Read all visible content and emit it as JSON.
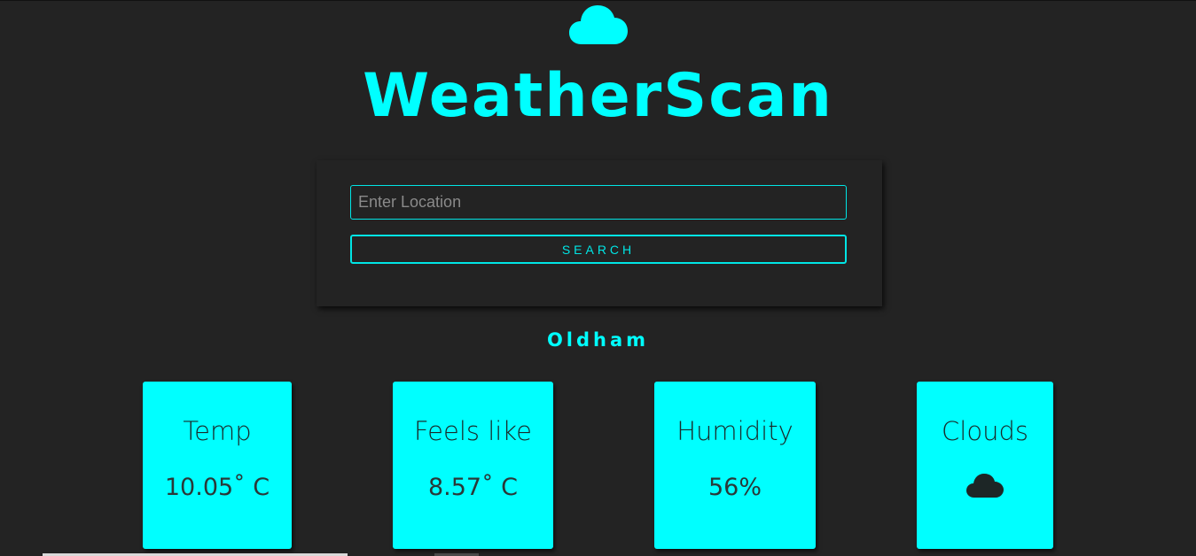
{
  "header": {
    "logo_icon": "cloud-icon",
    "title": "WeatherScan"
  },
  "search": {
    "placeholder": "Enter Location",
    "value": "",
    "button_label": "SEARCH"
  },
  "location": {
    "name": "Oldham"
  },
  "tiles": [
    {
      "label": "Temp",
      "value": "10.05˚ C"
    },
    {
      "label": "Feels like",
      "value": "8.57˚ C"
    },
    {
      "label": "Humidity",
      "value": "56%"
    },
    {
      "label": "Clouds",
      "icon": "cloud-icon"
    }
  ],
  "colors": {
    "background": "#232323",
    "accent": "#00ffff"
  }
}
